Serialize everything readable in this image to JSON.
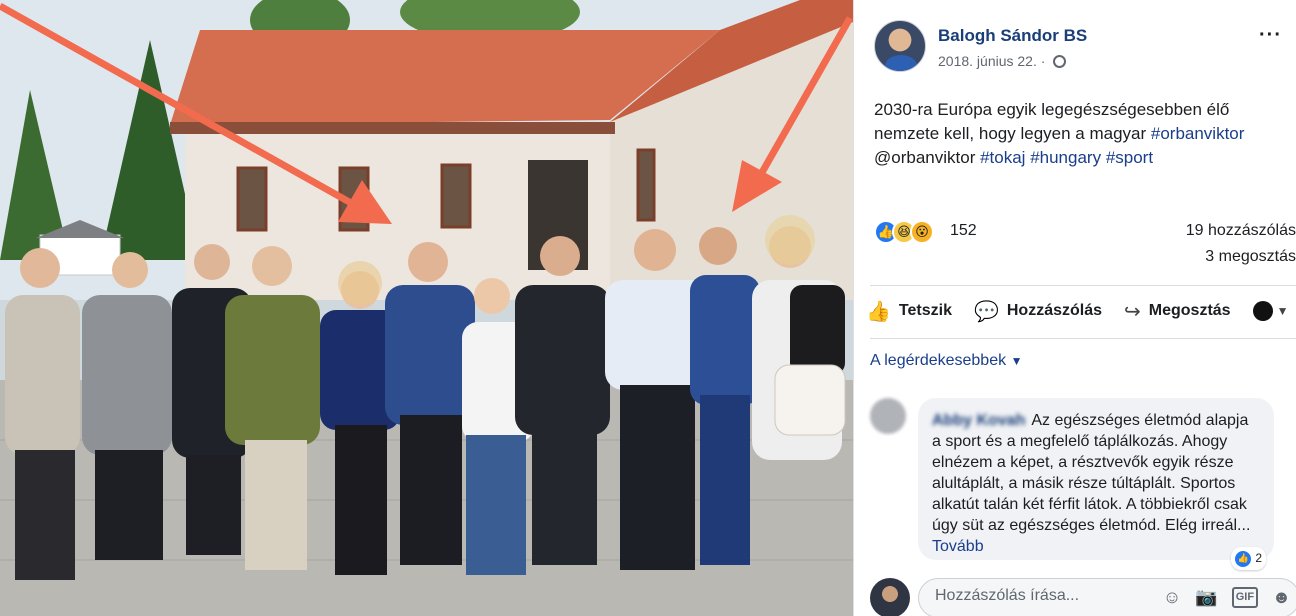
{
  "post": {
    "author": "Balogh Sándor BS",
    "date": "2018. június 22. ·",
    "more_icon": "···",
    "text_parts": [
      {
        "text": "2030-ra Európa egyik legegészségesebben élő nemzete kell, hogy legyen a magyar ",
        "tag": false
      },
      {
        "text": "#orbanviktor",
        "tag": true
      },
      {
        "text": " @orbanviktor ",
        "tag": false
      },
      {
        "text": "#tokaj",
        "tag": true
      },
      {
        "text": " ",
        "tag": false
      },
      {
        "text": "#hungary",
        "tag": true
      },
      {
        "text": " ",
        "tag": false
      },
      {
        "text": "#sport",
        "tag": true
      }
    ]
  },
  "stats": {
    "reaction_icons": [
      "like-icon",
      "haha-icon",
      "wow-icon"
    ],
    "reaction_count": "152",
    "comments": "19 hozzászólás",
    "shares": "3 megosztás"
  },
  "actions": {
    "like": "Tetszik",
    "comment": "Hozzászólás",
    "share": "Megosztás"
  },
  "sort_label": "A legérdekesebbek",
  "comment": {
    "author": "Abby Kovah",
    "text": "Az egészséges életmód alapja a sport és a megfelelő táplálkozás. Ahogy elnézem a képet, a résztvevők egyik része alultáplált, a másik része túltáplált. Sportos alkatút talán két férfit látok. A többiekről csak úgy süt az egészséges életmód. Elég irreál...",
    "more": "Tovább",
    "like_count": "2"
  },
  "composer": {
    "placeholder": "Hozzászólás írása..."
  },
  "colors": {
    "brand_link": "#1a3e8c",
    "like_blue": "#2078f4",
    "arrow": "#f26b4f"
  }
}
